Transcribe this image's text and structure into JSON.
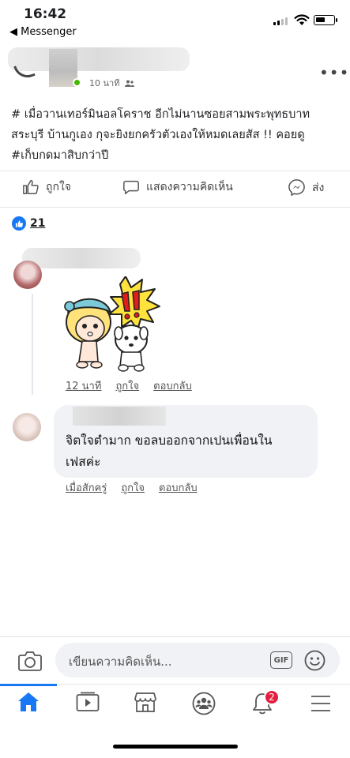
{
  "status_bar": {
    "time": "16:42",
    "back_label": "◀ Messenger"
  },
  "post": {
    "meta": "10 นาที",
    "text_line1": "# เมื่อวานเทอร์มินอลโคราช อีกไม่นานซอยสามพระพุทธบาท",
    "text_line2": "สระบุรี บ้านกูเอง กุจะยิงยกครัวตัวเองให้หมดเลยสัส !! คอยดู",
    "text_line3": "#เก็บกดมาสิบกว่าปี",
    "reaction_count": "21"
  },
  "actions": {
    "like_label": "ถูกใจ",
    "comment_label": "แสดงความคิดเห็น",
    "share_label": "ส่ง"
  },
  "comments": [
    {
      "time": "12 นาที",
      "like_label": "ถูกใจ",
      "reply_label": "ตอบกลับ"
    },
    {
      "text_line1": "จิตใจตำมาก ขอลบออกจากเปนเพื่อนใน",
      "text_line2": "เฟสค่ะ",
      "time": "เมื่อสักครู่",
      "like_label": "ถูกใจ",
      "reply_label": "ตอบกลับ"
    }
  ],
  "composer": {
    "placeholder": "เขียนความคิดเห็น...",
    "gif_label": "GIF"
  },
  "tabbar": {
    "notification_count": "2"
  },
  "colors": {
    "accent": "#1877f2",
    "badge": "#e41e3f",
    "online": "#44b700"
  }
}
